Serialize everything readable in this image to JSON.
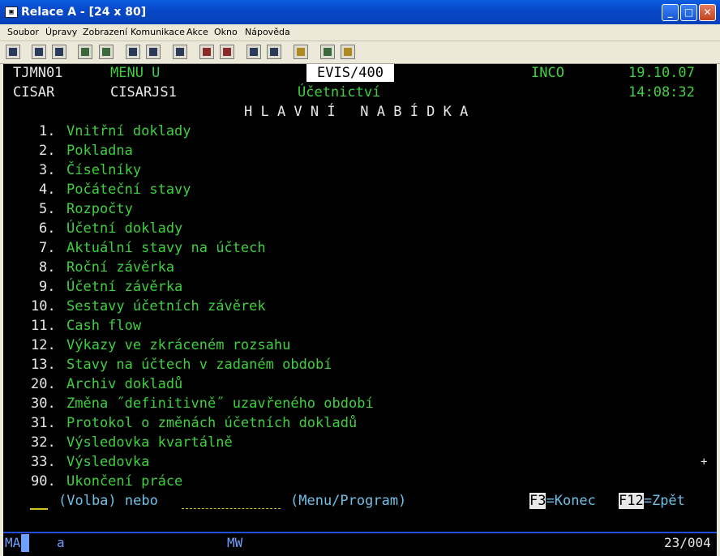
{
  "window": {
    "title": "Relace A - [24 x 80]",
    "app_icon": "terminal-icon",
    "buttons": [
      "minimize",
      "maximize",
      "close"
    ]
  },
  "menubar": [
    "Soubor",
    "Úpravy",
    "Zobrazení",
    "Komunikace",
    "Akce",
    "Okno",
    "Nápověda"
  ],
  "toolbar_icons": [
    "print-screen-icon",
    "copy-icon",
    "paste-icon",
    "send-icon",
    "receive-icon",
    "display-icon",
    "keypad-icon",
    "chart-icon",
    "macro-record-icon",
    "macro-play-icon",
    "transfer-up-icon",
    "transfer-down-icon",
    "clipboard-icon",
    "globe-icon",
    "help-icon"
  ],
  "terminal": {
    "program": "TJMN01",
    "menu": "MENU U",
    "system": "EVIS/400",
    "company": "INCO",
    "date": "19.10.07",
    "user": "CISAR",
    "job": "CISARJS1",
    "section": "Účetnictví",
    "time": "14:08:32",
    "heading": "H L A V N Í   N A B Í D K A",
    "options": [
      {
        "num": "1.",
        "label": "Vnitřní doklady"
      },
      {
        "num": "2.",
        "label": "Pokladna"
      },
      {
        "num": "3.",
        "label": "Číselníky"
      },
      {
        "num": "4.",
        "label": "Počáteční stavy"
      },
      {
        "num": "5.",
        "label": "Rozpočty"
      },
      {
        "num": "6.",
        "label": "Účetní doklady"
      },
      {
        "num": "7.",
        "label": "Aktuální stavy na účtech"
      },
      {
        "num": "8.",
        "label": "Roční závěrka"
      },
      {
        "num": "9.",
        "label": "Účetní závěrka"
      },
      {
        "num": "10.",
        "label": "Sestavy účetních závěrek"
      },
      {
        "num": "11.",
        "label": "Cash flow"
      },
      {
        "num": "12.",
        "label": "Výkazy ve zkráceném rozsahu"
      },
      {
        "num": "13.",
        "label": "Stavy na účtech v zadaném období"
      },
      {
        "num": "20.",
        "label": "Archiv dokladů"
      },
      {
        "num": "30.",
        "label": "Změna ˝definitivně˝ uzavřeného období"
      },
      {
        "num": "31.",
        "label": "Protokol o změnách účetních dokladů"
      },
      {
        "num": "32.",
        "label": "Výsledovka kvartálně"
      },
      {
        "num": "33.",
        "label": "Výsledovka"
      },
      {
        "num": "90.",
        "label": "Ukončení práce"
      }
    ],
    "more_indicator": "+",
    "prompt_volba": "(Volba) nebo",
    "prompt_menu": "(Menu/Program)",
    "f3_key": "F3",
    "f3_label": "=Konec",
    "f12_key": "F12",
    "f12_label": "=Zpět"
  },
  "status": {
    "mode": "MA",
    "shift": "a",
    "indicator": "MW",
    "position": "23/004"
  }
}
